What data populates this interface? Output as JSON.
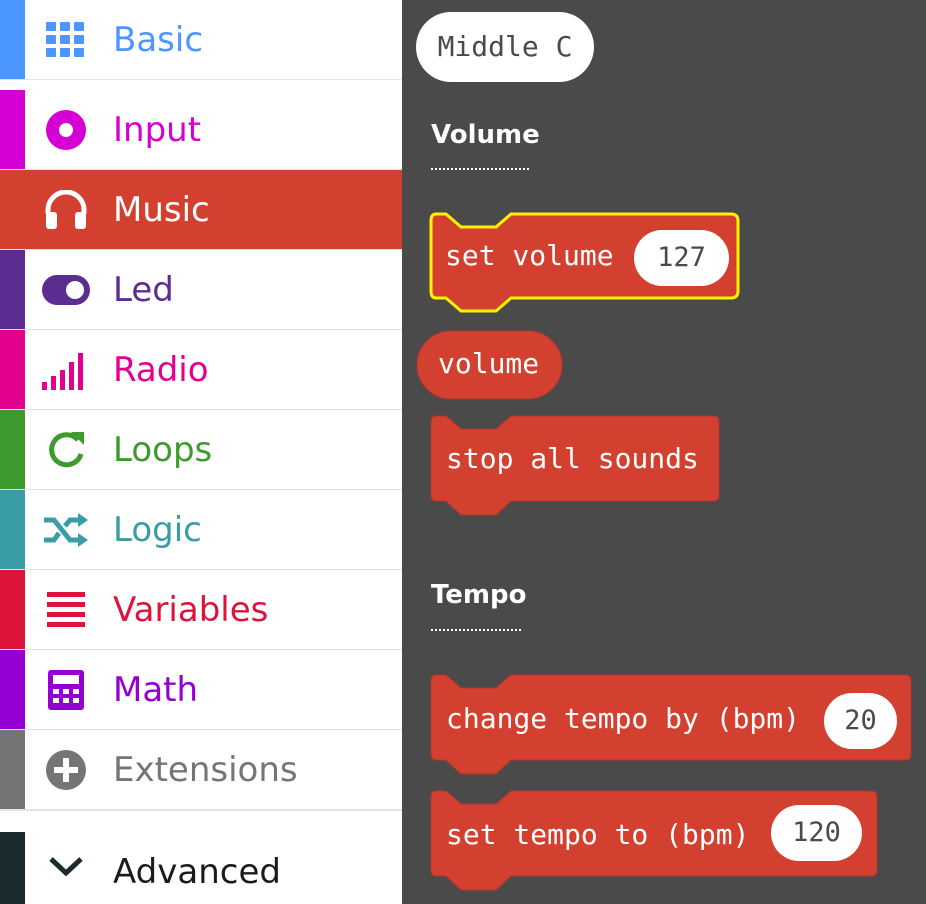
{
  "sidebar": {
    "categories": [
      {
        "label": "Basic",
        "color": "#4c97ff",
        "icon": "grid-icon"
      },
      {
        "label": "Input",
        "color": "#d400d4",
        "icon": "radio-button-icon"
      },
      {
        "label": "Music",
        "color": "#d44030",
        "icon": "headphones-icon",
        "selected": true
      },
      {
        "label": "Led",
        "color": "#5c2d91",
        "icon": "toggle-icon"
      },
      {
        "label": "Radio",
        "color": "#e3008c",
        "icon": "signal-bars-icon"
      },
      {
        "label": "Loops",
        "color": "#3d9b2d",
        "icon": "refresh-icon"
      },
      {
        "label": "Logic",
        "color": "#3a9da5",
        "icon": "shuffle-icon"
      },
      {
        "label": "Variables",
        "color": "#dc143c",
        "icon": "list-lines-icon"
      },
      {
        "label": "Math",
        "color": "#9400d3",
        "icon": "calculator-icon"
      },
      {
        "label": "Extensions",
        "color": "#757575",
        "icon": "plus-circle-icon"
      }
    ],
    "advanced": {
      "label": "Advanced",
      "icon": "chevron-down-icon"
    }
  },
  "flyout": {
    "top_pill": "Middle C",
    "sections": [
      {
        "title": "Volume"
      },
      {
        "title": "Tempo"
      }
    ],
    "blocks": {
      "set_volume": {
        "text": "set volume",
        "value": "127"
      },
      "volume": {
        "text": "volume"
      },
      "stop_all_sounds": {
        "text": "stop all sounds"
      },
      "change_tempo": {
        "text": "change tempo by (bpm)",
        "value": "20"
      },
      "set_tempo": {
        "text": "set tempo to (bpm)",
        "value": "120"
      }
    },
    "colors": {
      "block": "#d44030",
      "highlight": "#fff200",
      "background": "#4b4a4a"
    }
  }
}
